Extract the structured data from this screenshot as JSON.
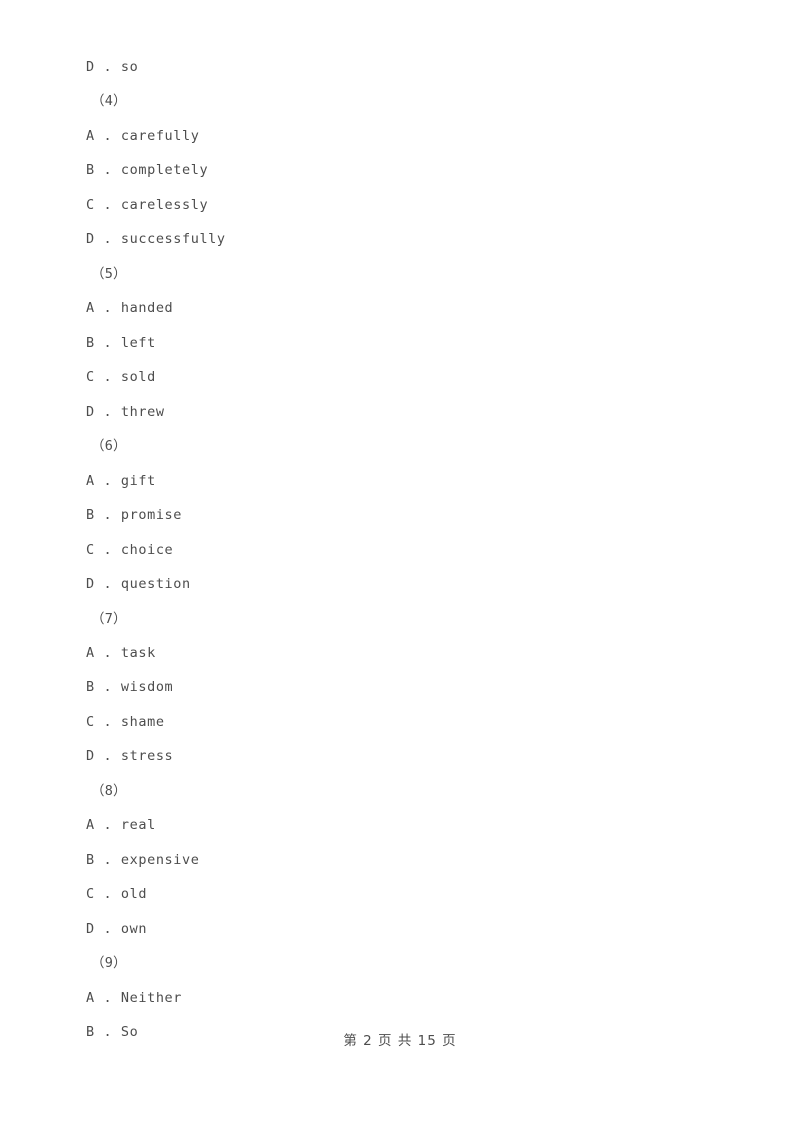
{
  "document": {
    "background_color": "#ffffff",
    "text_color": "#4d4d4d"
  },
  "body_lines": [
    {
      "type": "option",
      "text": "D . so"
    },
    {
      "type": "qnum",
      "text": "（4）"
    },
    {
      "type": "option",
      "text": "A . carefully"
    },
    {
      "type": "option",
      "text": "B . completely"
    },
    {
      "type": "option",
      "text": "C . carelessly"
    },
    {
      "type": "option",
      "text": "D . successfully"
    },
    {
      "type": "qnum",
      "text": "（5）"
    },
    {
      "type": "option",
      "text": "A . handed"
    },
    {
      "type": "option",
      "text": "B . left"
    },
    {
      "type": "option",
      "text": "C . sold"
    },
    {
      "type": "option",
      "text": "D . threw"
    },
    {
      "type": "qnum",
      "text": "（6）"
    },
    {
      "type": "option",
      "text": "A . gift"
    },
    {
      "type": "option",
      "text": "B . promise"
    },
    {
      "type": "option",
      "text": "C . choice"
    },
    {
      "type": "option",
      "text": "D . question"
    },
    {
      "type": "qnum",
      "text": "（7）"
    },
    {
      "type": "option",
      "text": "A . task"
    },
    {
      "type": "option",
      "text": "B . wisdom"
    },
    {
      "type": "option",
      "text": "C . shame"
    },
    {
      "type": "option",
      "text": "D . stress"
    },
    {
      "type": "qnum",
      "text": "（8）"
    },
    {
      "type": "option",
      "text": "A . real"
    },
    {
      "type": "option",
      "text": "B . expensive"
    },
    {
      "type": "option",
      "text": "C . old"
    },
    {
      "type": "option",
      "text": "D . own"
    },
    {
      "type": "qnum",
      "text": "（9）"
    },
    {
      "type": "option",
      "text": "A . Neither"
    },
    {
      "type": "option",
      "text": "B . So"
    }
  ],
  "footer": {
    "text": "第 2 页 共 15 页",
    "current_page": "2",
    "total_pages": "15"
  }
}
